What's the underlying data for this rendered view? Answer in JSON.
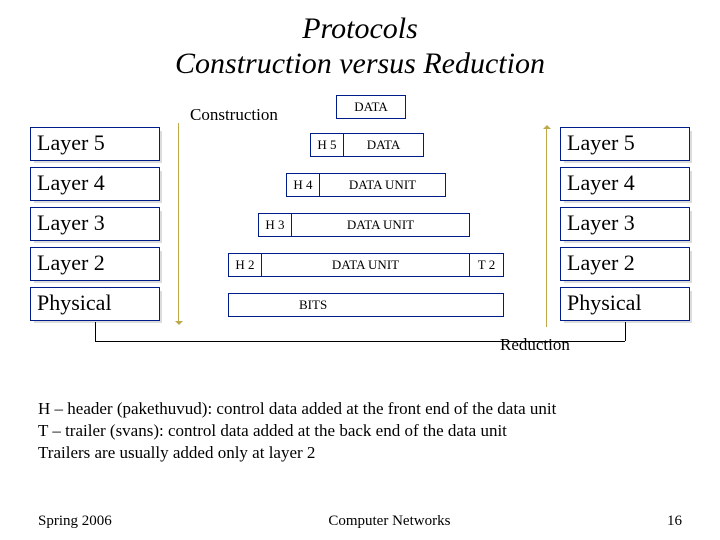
{
  "title_line1": "Protocols",
  "title_line2": "Construction versus Reduction",
  "labels": {
    "construction": "Construction",
    "reduction": "Reduction"
  },
  "left_layers": [
    "Layer 5",
    "Layer 4",
    "Layer 3",
    "Layer 2",
    "Physical"
  ],
  "right_layers": [
    "Layer 5",
    "Layer 4",
    "Layer 3",
    "Layer 2",
    "Physical"
  ],
  "pdus": {
    "row0": {
      "body": "DATA"
    },
    "row1": {
      "h": "H 5",
      "body": "DATA"
    },
    "row2": {
      "h": "H 4",
      "body": "DATA UNIT"
    },
    "row3": {
      "h": "H 3",
      "body": "DATA UNIT"
    },
    "row4": {
      "h": "H 2",
      "body": "DATA UNIT",
      "t": "T 2"
    },
    "row5": {
      "body": "BITS"
    }
  },
  "notes_line1": "H – header (pakethuvud): control data added at the front end of the data unit",
  "notes_line2": "T – trailer (svans): control data added at the back end of the data unit",
  "notes_line3": "Trailers are usually added only at layer 2",
  "footer": {
    "left": "Spring 2006",
    "center": "Computer Networks",
    "right": "16"
  }
}
